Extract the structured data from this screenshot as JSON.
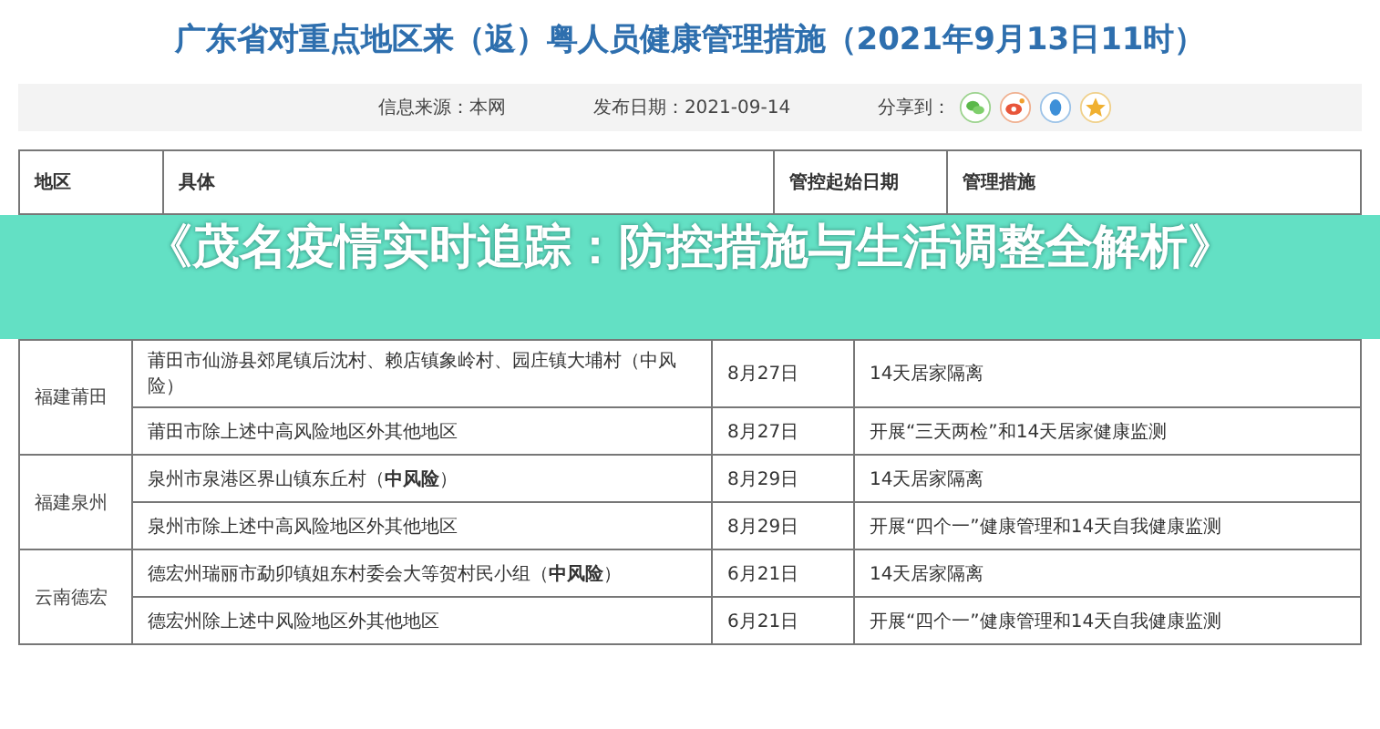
{
  "title": "广东省对重点地区来（返）粤人员健康管理措施（2021年9月13日11时）",
  "info": {
    "source": "信息来源：本网",
    "date": "发布日期：2021-09-14",
    "share_label": "分享到："
  },
  "table": {
    "columns": [
      "地区",
      "具体",
      "管控起始日期",
      "管理措施"
    ],
    "groups": [
      {
        "region": "福建莆田",
        "rows": [
          {
            "detail": "莆田市仙游县郊尾镇后沈村、赖店镇象岭村、园庄镇大埔村（中风险）",
            "date": "8月27日",
            "measure": "14天居家隔离"
          },
          {
            "detail": "莆田市除上述中高风险地区外其他地区",
            "date": "8月27日",
            "measure": "开展“三天两检”和14天居家健康监测"
          }
        ]
      },
      {
        "region": "福建泉州",
        "rows": [
          {
            "detail": "泉州市泉港区界山镇东丘村（**中风险**）",
            "date": "8月29日",
            "measure": "14天居家隔离"
          },
          {
            "detail": "泉州市除上述中高风险地区外其他地区",
            "date": "8月29日",
            "measure": "开展“四个一”健康管理和14天自我健康监测"
          }
        ]
      },
      {
        "region": "云南德宏",
        "rows": [
          {
            "detail": "德宏州瑞丽市勐卯镇姐东村委会大等贺村民小组（**中风险**）",
            "date": "6月21日",
            "measure": "14天居家隔离"
          },
          {
            "detail": "德宏州除上述中风险地区外其他地区",
            "date": "6月21日",
            "measure": "开展“四个一”健康管理和14天自我健康监测"
          }
        ]
      }
    ]
  },
  "banner": "《茂名疫情实时追踪：防控措施与生活调整全解析》"
}
